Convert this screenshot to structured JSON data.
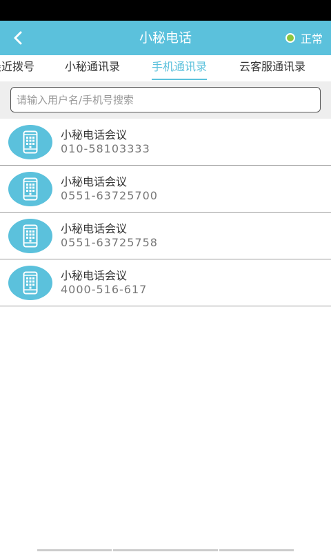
{
  "header": {
    "title": "小秘电话",
    "status_label": "正常",
    "status_color": "#8cc63f",
    "accent_color": "#5bc1dc",
    "back_icon": "chevron-left-icon"
  },
  "tabs": [
    {
      "label": "最近拨号",
      "active": false
    },
    {
      "label": "小秘通讯录",
      "active": false
    },
    {
      "label": "手机通讯录",
      "active": true
    },
    {
      "label": "云客服通讯录",
      "active": false
    }
  ],
  "search": {
    "value": "",
    "placeholder": "请输入用户名/手机号搜索"
  },
  "contacts": [
    {
      "name": "小秘电话会议",
      "number": "010-58103333",
      "icon": "phone-icon"
    },
    {
      "name": "小秘电话会议",
      "number": "0551-63725700",
      "icon": "phone-icon"
    },
    {
      "name": "小秘电话会议",
      "number": "0551-63725758",
      "icon": "phone-icon"
    },
    {
      "name": "小秘电话会议",
      "number": "4000-516-617",
      "icon": "phone-icon"
    }
  ]
}
